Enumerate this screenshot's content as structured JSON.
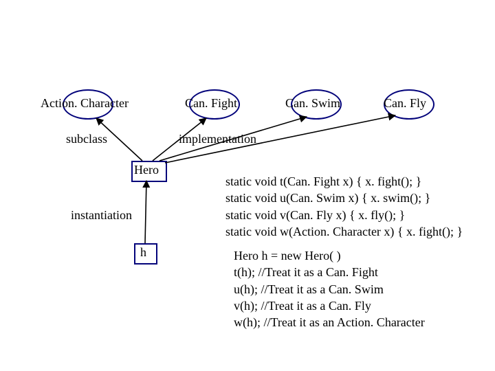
{
  "nodes": {
    "actionCharacter": "Action. Character",
    "canFight": "Can. Fight",
    "canSwim": "Can. Swim",
    "canFly": "Can. Fly",
    "hero": "Hero",
    "h": "h"
  },
  "labels": {
    "subclass": "subclass",
    "implementation": "implementation",
    "instantiation": "instantiation"
  },
  "code": {
    "methods": "static void t(Can. Fight x) { x. fight(); }\nstatic void u(Can. Swim x) { x. swim(); }\nstatic void v(Can. Fly x) { x. fly(); }\nstatic void w(Action. Character x) { x. fight(); }",
    "usage": "Hero h = new Hero( )\nt(h); //Treat it as a Can. Fight\nu(h); //Treat it as a Can. Swim\nv(h); //Treat it as a Can. Fly\nw(h); //Treat it as an Action. Character"
  }
}
